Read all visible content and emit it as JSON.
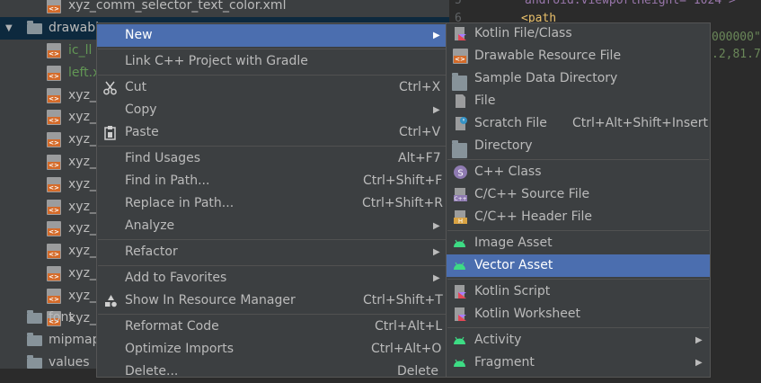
{
  "tree": {
    "top_file": "xyz_comm_selector_text_color.xml",
    "drawable_folder": "drawable",
    "items": [
      {
        "label": "ic_ll",
        "color": "#629755"
      },
      {
        "label": "left.x",
        "color": "#629755"
      },
      {
        "label": "xyz_c",
        "color": "#bbbbbb"
      },
      {
        "label": "xyz_c",
        "color": "#bbbbbb"
      },
      {
        "label": "xyz_c",
        "color": "#bbbbbb"
      },
      {
        "label": "xyz_c",
        "color": "#bbbbbb"
      },
      {
        "label": "xyz_c",
        "color": "#bbbbbb"
      },
      {
        "label": "xyz_c",
        "color": "#bbbbbb"
      },
      {
        "label": "xyz_c",
        "color": "#bbbbbb"
      },
      {
        "label": "xyz_c",
        "color": "#bbbbbb"
      },
      {
        "label": "xyz_c",
        "color": "#bbbbbb"
      },
      {
        "label": "xyz_c",
        "color": "#bbbbbb"
      },
      {
        "label": "xyz_c",
        "color": "#bbbbbb"
      }
    ],
    "folders": [
      "font",
      "mipmap",
      "values"
    ]
  },
  "editor": {
    "line_numbers": [
      "5",
      "6"
    ],
    "line1": "android:viewportHeight=\"1024\">",
    "line2": "<path",
    "line3": "000000\"",
    "line4": ".2,81.7"
  },
  "context_menu": {
    "new": "New",
    "link_cpp": "Link C++ Project with Gradle",
    "cut": "Cut",
    "cut_sc": "Ctrl+X",
    "copy": "Copy",
    "paste": "Paste",
    "paste_sc": "Ctrl+V",
    "find_usages": "Find Usages",
    "find_usages_sc": "Alt+F7",
    "find_in_path": "Find in Path...",
    "find_in_path_sc": "Ctrl+Shift+F",
    "replace_in_path": "Replace in Path...",
    "replace_in_path_sc": "Ctrl+Shift+R",
    "analyze": "Analyze",
    "refactor": "Refactor",
    "add_favorites": "Add to Favorites",
    "show_resource_manager": "Show In Resource Manager",
    "show_resource_manager_sc": "Ctrl+Shift+T",
    "reformat": "Reformat Code",
    "reformat_sc": "Ctrl+Alt+L",
    "optimize": "Optimize Imports",
    "optimize_sc": "Ctrl+Alt+O",
    "delete": "Delete...",
    "delete_sc": "Delete"
  },
  "submenu": {
    "kotlin_file": "Kotlin File/Class",
    "drawable_res": "Drawable Resource File",
    "sample_data": "Sample Data Directory",
    "file": "File",
    "scratch": "Scratch File",
    "scratch_sc": "Ctrl+Alt+Shift+Insert",
    "directory": "Directory",
    "cpp_class": "C++ Class",
    "cpp_source": "C/C++ Source File",
    "cpp_header": "C/C++ Header File",
    "image_asset": "Image Asset",
    "vector_asset": "Vector Asset",
    "kotlin_script": "Kotlin Script",
    "kotlin_worksheet": "Kotlin Worksheet",
    "activity": "Activity",
    "fragment": "Fragment"
  },
  "colors": {
    "menu_bg": "#3c3f41",
    "highlight": "#4b6eaf",
    "android_green": "#3ddc84",
    "kotlin_purple": "#a97bff",
    "xml_orange": "#d46b2a"
  }
}
